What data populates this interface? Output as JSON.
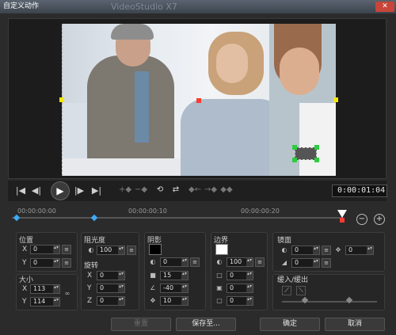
{
  "window": {
    "title": "自定义动作",
    "title_ghost": "VideoStudio X7",
    "close_glyph": "✕"
  },
  "playback": {
    "timecode": "0:00:01:04",
    "buttons": {
      "home": "|◀",
      "prev": "◀|",
      "play": "▶",
      "next": "|▶",
      "end": "▶|"
    }
  },
  "timeline": {
    "ticks": [
      "00:00:00:00",
      "00:00:00:10",
      "00:00:00:20"
    ],
    "zoom_out": "−",
    "zoom_in": "+"
  },
  "position": {
    "title": "位置",
    "x_label": "X",
    "x_value": "0",
    "y_label": "Y",
    "y_value": "0"
  },
  "size": {
    "title": "大小",
    "x_label": "X",
    "x_value": "113",
    "y_label": "Y",
    "y_value": "114"
  },
  "opacity": {
    "title": "阻光度",
    "value": "100"
  },
  "rotation": {
    "title": "旋转",
    "x_label": "X",
    "x_value": "0",
    "y_label": "Y",
    "y_value": "0",
    "z_label": "Z",
    "z_value": "0"
  },
  "shadow": {
    "title": "阴影",
    "color": "#000000",
    "opacity": "0",
    "blur": "15",
    "angle": "-40",
    "distance": "10"
  },
  "border": {
    "title": "边界",
    "color": "#ffffff",
    "opacity": "100",
    "v1": "0",
    "v2": "0",
    "v3": "0"
  },
  "mirror": {
    "title": "镜面",
    "v1": "0",
    "v2": "0",
    "v3": "0"
  },
  "fade": {
    "title": "缓入/缓出"
  },
  "footer": {
    "reset": "重置",
    "save_as": "保存至...",
    "ok": "确定",
    "cancel": "取消"
  },
  "colors": {
    "accent": "#3fa9f5",
    "keyframe_red": "#ff3b30",
    "handle_yellow": "#f2e600",
    "handle_green": "#2ecc40"
  },
  "icons": [
    "play-icon",
    "zoom-in-icon",
    "zoom-out-icon",
    "link-icon",
    "move-icon"
  ]
}
